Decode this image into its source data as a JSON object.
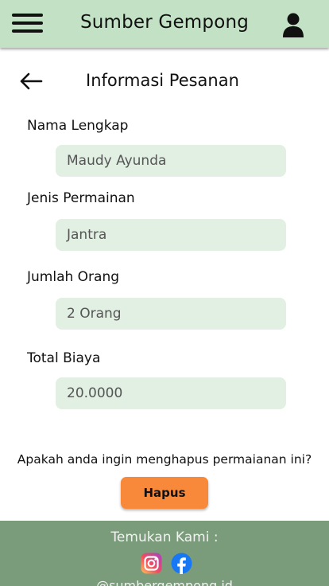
{
  "header": {
    "title": "Sumber Gempong",
    "menu_icon": "hamburger-menu-icon",
    "user_icon": "user-icon"
  },
  "page": {
    "title": "Informasi Pesanan",
    "back_icon": "back-arrow-icon"
  },
  "form": {
    "full_name": {
      "label": "Nama Lengkap",
      "value": "Maudy Ayunda"
    },
    "game_type": {
      "label": "Jenis Permainan",
      "value": "Jantra"
    },
    "people_count": {
      "label": "Jumlah Orang",
      "value": "2 Orang"
    },
    "total_cost": {
      "label": "Total Biaya",
      "value": "20.0000"
    }
  },
  "confirm": {
    "question": "Apakah anda ingin menghapus permaianan ini?",
    "delete_label": "Hapus"
  },
  "footer": {
    "title": "Temukan Kami :",
    "handle": "@sumbergempong.id",
    "social_icons": [
      "instagram-icon",
      "facebook-icon"
    ]
  },
  "colors": {
    "header_bg": "#c3e1c4",
    "field_bg": "#e2efe3",
    "button": "#f9893a",
    "footer_bg": "#7a9c7b"
  }
}
